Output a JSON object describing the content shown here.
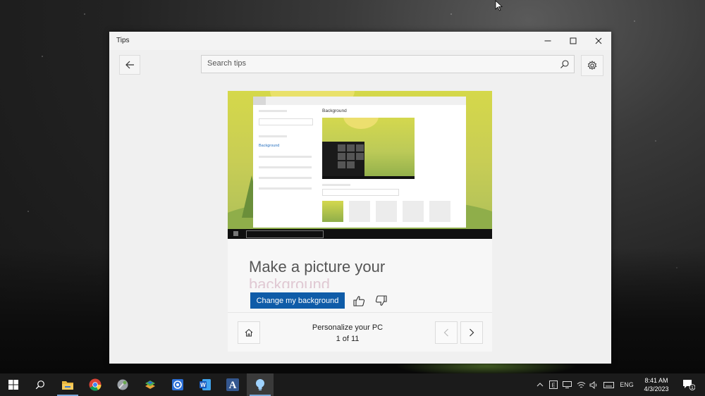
{
  "window": {
    "title": "Tips",
    "minimize_icon": "minimize-icon",
    "maximize_icon": "maximize-icon",
    "close_icon": "close-icon"
  },
  "toolbar": {
    "back_icon": "back-arrow-icon",
    "search_placeholder": "Search tips",
    "search_icon": "search-icon",
    "settings_icon": "gear-icon"
  },
  "tip": {
    "hero_mock": {
      "title": "Background",
      "sidebar_link": "Background"
    },
    "title_line1": "Make a picture your",
    "title_line2": "background",
    "primary_button": "Change my background",
    "thumbs_up_icon": "thumbs-up-icon",
    "thumbs_down_icon": "thumbs-down-icon"
  },
  "navigation": {
    "home_icon": "home-icon",
    "collection_title": "Personalize your PC",
    "position": "1 of 11",
    "prev_icon": "chevron-left-icon",
    "next_icon": "chevron-right-icon"
  },
  "taskbar": {
    "apps": [
      {
        "name": "start",
        "icon": "windows-icon"
      },
      {
        "name": "search",
        "icon": "search-icon"
      },
      {
        "name": "file-explorer",
        "icon": "folder-icon"
      },
      {
        "name": "chrome",
        "icon": "chrome-icon"
      },
      {
        "name": "app-5",
        "icon": "app-icon"
      },
      {
        "name": "app-6",
        "icon": "app-icon"
      },
      {
        "name": "app-7",
        "icon": "app-icon"
      },
      {
        "name": "word",
        "icon": "word-icon"
      },
      {
        "name": "font-app",
        "icon": "letter-a-icon"
      },
      {
        "name": "tips",
        "icon": "lightbulb-icon"
      }
    ],
    "language": "ENG",
    "time": "8:41 AM",
    "date": "4/3/2023",
    "notification_count": "1"
  },
  "colors": {
    "accent": "#0f5ca8",
    "taskbar": "#1b1b1b",
    "window_bg": "#f0f0f0"
  }
}
